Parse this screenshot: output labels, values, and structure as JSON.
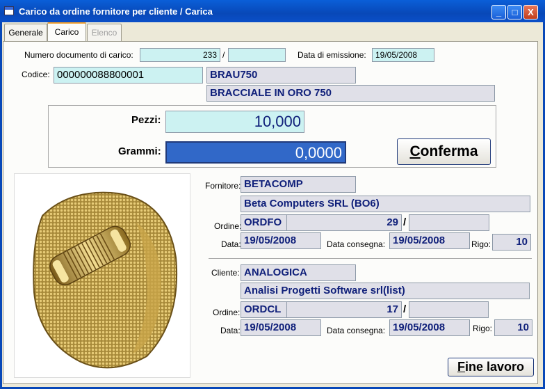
{
  "window": {
    "title": "Carico da ordine fornitore per cliente / Carica",
    "minimize": "_",
    "maximize": "□",
    "close": "X"
  },
  "tabs": [
    {
      "label": "Generale"
    },
    {
      "label": "Carico"
    },
    {
      "label": "Elenco"
    }
  ],
  "doc": {
    "numero_label": "Numero documento di carico:",
    "numero_value": "233",
    "numero_sep": "/",
    "numero_suffix": "",
    "data_label": "Data di emissione:",
    "data_value": "19/05/2008"
  },
  "articolo": {
    "codice_label": "Codice:",
    "codice_value": "000000088800001",
    "sigla": "BRAU750",
    "descrizione": "BRACCIALE IN ORO 750"
  },
  "quantita": {
    "pezzi_label": "Pezzi:",
    "pezzi_value": "10,000",
    "grammi_label": "Grammi:",
    "grammi_value": "0,0000",
    "conferma_label": "onferma",
    "conferma_mnemonic": "C"
  },
  "fornitore": {
    "label": "Fornitore:",
    "codice": "BETACOMP",
    "ragione_sociale": "Beta Computers SRL (BO6)",
    "ordine_label": "Ordine:",
    "ordine_tipo": "ORDFO",
    "ordine_numero": "29",
    "ordine_sep": "/",
    "ordine_suffix": "",
    "data_label": "Data:",
    "data_value": "19/05/2008",
    "consegna_label": "Data consegna:",
    "consegna_value": "19/05/2008",
    "rigo_label": "Rigo:",
    "rigo_value": "10"
  },
  "cliente": {
    "label": "Cliente:",
    "codice": "ANALOGICA",
    "ragione_sociale": "Analisi Progetti Software srl(list)",
    "ordine_label": "Ordine:",
    "ordine_tipo": "ORDCL",
    "ordine_numero": "17",
    "ordine_sep": "/",
    "ordine_suffix": "",
    "data_label": "Data:",
    "data_value": "19/05/2008",
    "consegna_label": "Data consegna:",
    "consegna_value": "19/05/2008",
    "rigo_label": "Rigo:",
    "rigo_value": "10"
  },
  "footer": {
    "fine_mnemonic": "F",
    "fine_label": "ine lavoro"
  },
  "colors": {
    "titlebar": "#0848b8",
    "field_gray": "#e0e0e8",
    "field_cyan": "#ccf2f2",
    "selected_field": "#3168c8",
    "field_text": "#10207a"
  }
}
